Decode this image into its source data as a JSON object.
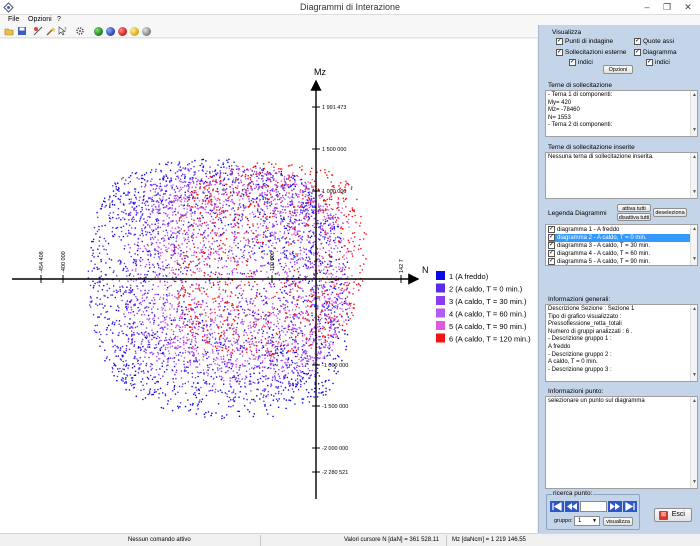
{
  "window": {
    "title": "Diagrammi di Interazione",
    "min": "–",
    "max": "❐",
    "close": "✕"
  },
  "menu": [
    "File",
    "Opzioni",
    "?"
  ],
  "toolbar_balls": [
    "#1b7a16",
    "#1e3fa9",
    "#c61a1a",
    "#e3c21b",
    "#8a8a8a"
  ],
  "plot": {
    "axis_x_name": "N",
    "axis_y_name": "Mz",
    "y_ticks": [
      "1 991 473",
      "1 500 000",
      "1 000 000",
      "-1 000 000",
      "-1 500 000",
      "-2 000 000",
      "-2 280 521"
    ],
    "x_ticks": [
      "-454 408",
      "-400 000",
      "-100 000",
      "142 7"
    ],
    "legend": [
      {
        "label": "1 (A freddo)",
        "color": "#0a0ae6"
      },
      {
        "label": "2 (A caldo, T = 0 min.)",
        "color": "#5a2bea"
      },
      {
        "label": "3 (A caldo, T = 30 min.)",
        "color": "#8a3cf2"
      },
      {
        "label": "4 (A caldo, T = 60 min.)",
        "color": "#b05cf5"
      },
      {
        "label": "5 (A caldo, T = 90 min.)",
        "color": "#e05ae0"
      },
      {
        "label": "6 (A caldo, T = 120 min.)",
        "color": "#f01515"
      }
    ]
  },
  "panel": {
    "visualizza_label": "Visualizza",
    "cb_punti": "Punti di indagine",
    "cb_quote": "Quote assi",
    "cb_sollecitazioni": "Sollecitazioni esterne",
    "cb_diagramma": "Diagramma",
    "cb_indici1": "indici",
    "cb_indici2": "indici",
    "opzioni_button": "Opzioni",
    "terne_label": "Terne di sollecitazione",
    "terne_lines": [
      "- Terna  1 di componenti:",
      "My= 420",
      "Mz= -78460",
      "N= 1553",
      "- Terna  2 di componenti:"
    ],
    "terne_ins_label": "Terne di sollecitazione inserite",
    "terne_ins_text": "Nessuna terna di sollecitazione inserita.",
    "legenda_label": "Legenda Diagrammi",
    "attiva_button": "attiva tutti",
    "disattiva_button": "disattiva tutti",
    "deseleziona_button": "deseleziona",
    "legenda_items": [
      "diagramma 1 - A freddo",
      "diagramma 2 - A caldo, T = 0 min.",
      "diagramma 3 - A caldo, T = 30 min.",
      "diagramma 4 - A caldo, T = 60 min.",
      "diagramma 5 - A caldo, T = 90 min."
    ],
    "info_gen_label": "Informazioni generali:",
    "info_gen_lines": [
      "Descrizione Sezione : Sezione 1",
      "Tipo di grafico visualizzato :",
      "Pressoflessione_retta_totali",
      "Numero di gruppi analizzati : 6 .",
      "- Descrizione gruppo 1 :",
      "A freddo",
      "- Descrizione gruppo 2 :",
      "A caldo, T = 0 min.",
      "- Descrizione gruppo 3 :"
    ],
    "info_punto_label": "Informazioni punto:",
    "info_punto_text": "selezionare un punto sul diagramma",
    "ricerca_label": "ricerca punto:",
    "gruppo_label": "gruppo:",
    "gruppo_value": "1",
    "visualizza_button": "visualizza",
    "esci_button": "Esci"
  },
  "status": {
    "command": "Nessun comando attivo",
    "cursor_n": "Valori cursore  N [daN] = 361 528.11",
    "cursor_mz": "Mz [daNcm] = 1 219 146.55"
  }
}
